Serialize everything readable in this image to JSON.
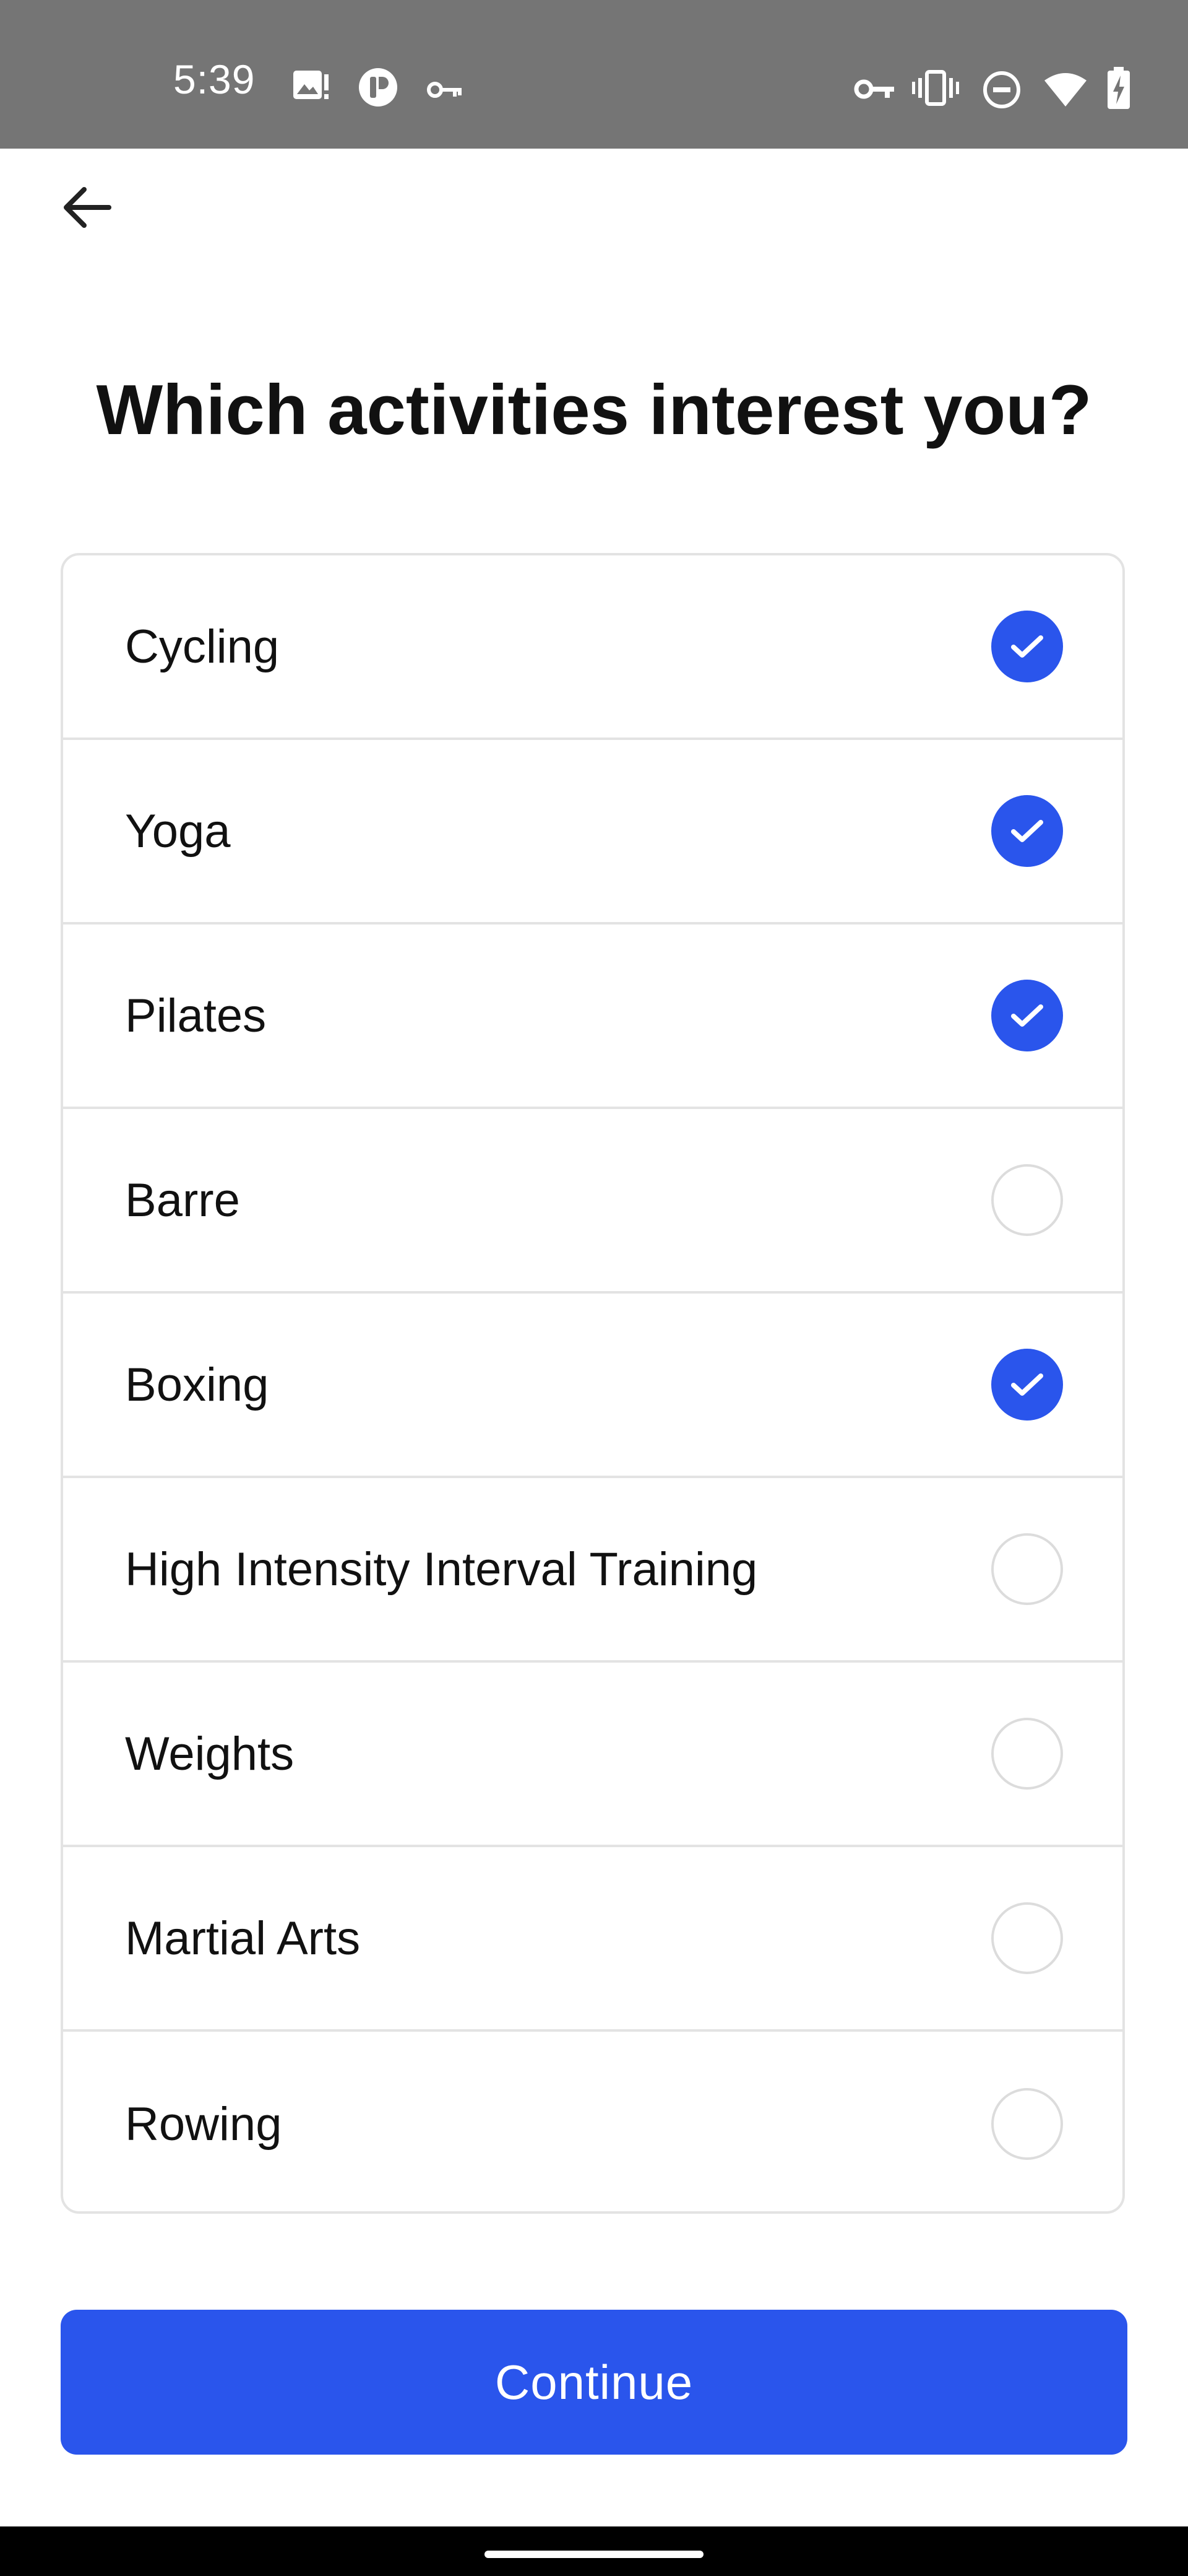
{
  "status_bar": {
    "time": "5:39",
    "left_icons": [
      "image-icon",
      "p-app-icon",
      "key-icon"
    ],
    "right_icons": [
      "vpn-key-icon",
      "vibrate-icon",
      "do-not-disturb-icon",
      "wifi-icon",
      "battery-charging-icon"
    ]
  },
  "header": {
    "back_icon": "arrow-left-icon",
    "title": "Which activities interest you?"
  },
  "activities": [
    {
      "label": "Cycling",
      "checked": true
    },
    {
      "label": "Yoga",
      "checked": true
    },
    {
      "label": "Pilates",
      "checked": true
    },
    {
      "label": "Barre",
      "checked": false
    },
    {
      "label": "Boxing",
      "checked": true
    },
    {
      "label": "High Intensity Interval Training",
      "checked": false
    },
    {
      "label": "Weights",
      "checked": false
    },
    {
      "label": "Martial Arts",
      "checked": false
    },
    {
      "label": "Rowing",
      "checked": false
    }
  ],
  "footer": {
    "continue_label": "Continue"
  },
  "colors": {
    "accent": "#2a55ec",
    "status_bar": "#757575",
    "divider": "#e3e3e3"
  }
}
